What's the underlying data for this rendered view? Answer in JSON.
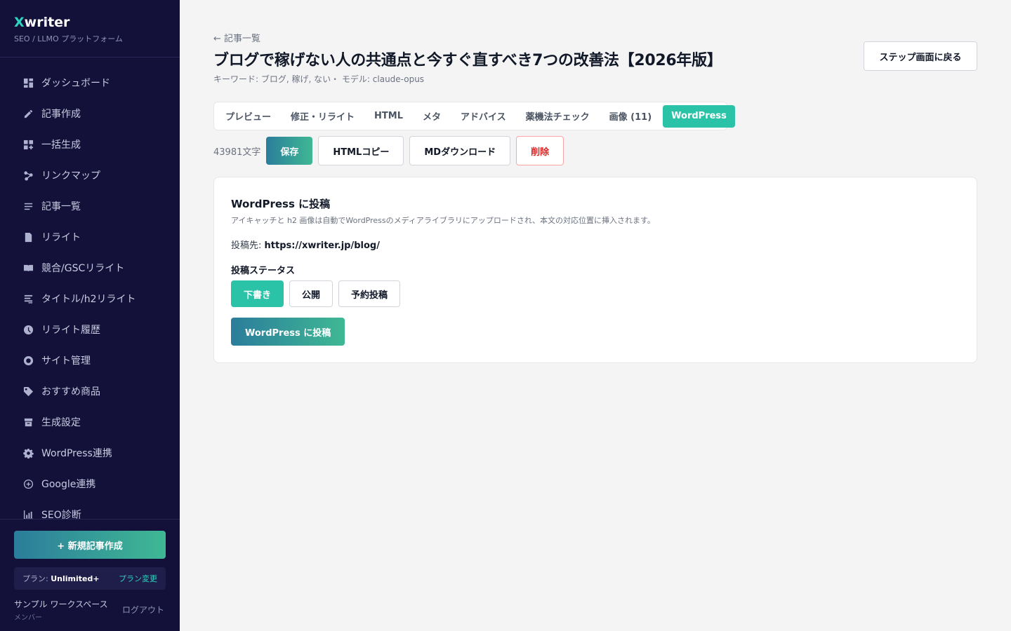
{
  "brand": {
    "x": "X",
    "rest": "writer",
    "subtitle": "SEO / LLMO プラットフォーム"
  },
  "sidebar": {
    "items": [
      {
        "label": "ダッシュボード",
        "icon": "dashboard-icon"
      },
      {
        "label": "記事作成",
        "icon": "pencil-icon"
      },
      {
        "label": "一括生成",
        "icon": "grid-plus-icon"
      },
      {
        "label": "リンクマップ",
        "icon": "network-icon"
      },
      {
        "label": "記事一覧",
        "icon": "list-icon"
      },
      {
        "label": "リライト",
        "icon": "document-icon"
      },
      {
        "label": "競合/GSCリライト",
        "icon": "book-icon"
      },
      {
        "label": "タイトル/h2リライト",
        "icon": "title-icon"
      },
      {
        "label": "リライト履歴",
        "icon": "clock-icon"
      },
      {
        "label": "サイト管理",
        "icon": "site-icon"
      },
      {
        "label": "おすすめ商品",
        "icon": "tag-icon"
      },
      {
        "label": "生成設定",
        "icon": "archive-icon"
      },
      {
        "label": "WordPress連携",
        "icon": "gear-icon"
      },
      {
        "label": "Google連携",
        "icon": "plus-circle-icon"
      },
      {
        "label": "SEO診断",
        "icon": "chart-icon"
      }
    ],
    "new_button": "+ 新規記事作成",
    "plan_prefix": "プラン: ",
    "plan_name": "Unlimited+",
    "plan_change": "プラン変更",
    "workspace_name": "サンプル ワークスペース",
    "workspace_role": "メンバー",
    "logout": "ログアウト"
  },
  "header": {
    "back_link": "← 記事一覧",
    "title": "ブログで稼げない人の共通点と今すぐ直すべき7つの改善法【2026年版】",
    "meta": "キーワード: ブログ, 稼げ, ない・ モデル: claude-opus",
    "step_back": "ステップ画面に戻る"
  },
  "tabs": [
    "プレビュー",
    "修正・リライト",
    "HTML",
    "メタ",
    "アドバイス",
    "薬機法チェック",
    "画像 (11)",
    "WordPress"
  ],
  "active_tab": "WordPress",
  "actions": {
    "char_count": "43981文字",
    "save": "保存",
    "html_copy": "HTMLコピー",
    "md_download": "MDダウンロード",
    "delete": "削除"
  },
  "wp_card": {
    "title": "WordPress に投稿",
    "description": "アイキャッチと h2 画像は自動でWordPressのメディアライブラリにアップロードされ、本文の対応位置に挿入されます。",
    "dest_label": "投稿先: ",
    "dest_url": "https://xwriter.jp/blog/",
    "status_label": "投稿ステータス",
    "status_options": [
      "下書き",
      "公開",
      "予約投稿"
    ],
    "selected_status": "下書き",
    "post_button": "WordPress に投稿"
  },
  "colors": {
    "sidebar_bg": "#13113a",
    "accent": "#2bc3a8",
    "danger": "#dc2626",
    "gradient_start": "#2b7d9b",
    "gradient_end": "#3fb894"
  }
}
